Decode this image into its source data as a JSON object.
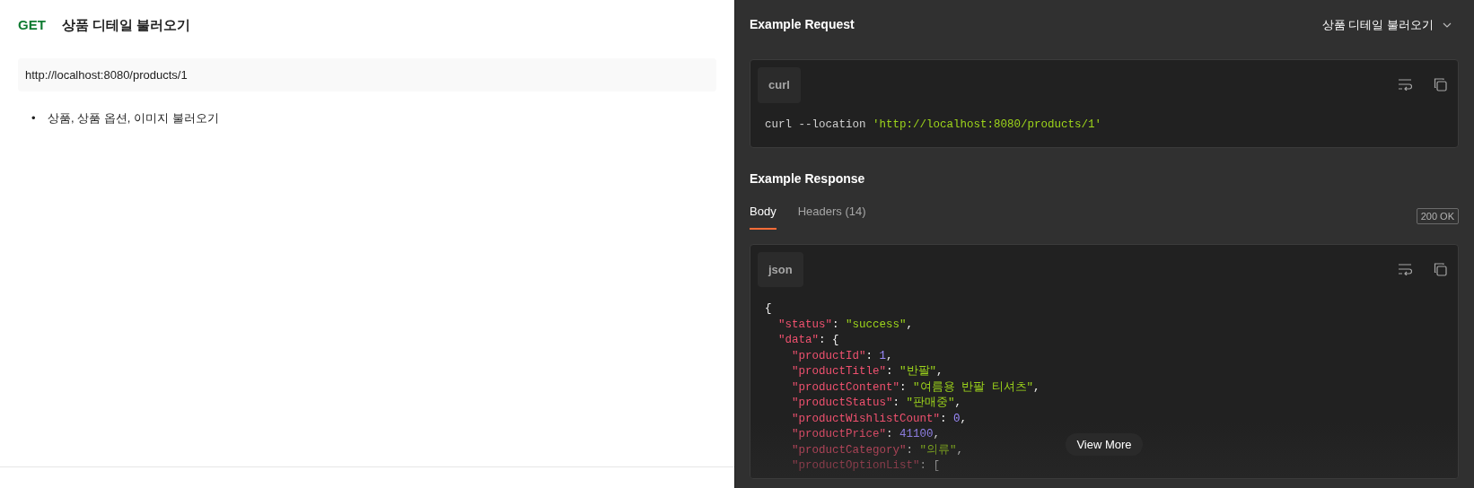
{
  "method": "GET",
  "title": "상품 디테일 불러오기",
  "url": "http://localhost:8080/products/1",
  "description_items": [
    {
      "bullet": "•",
      "text": "상품, 상품 옵션, 이미지 불러오기"
    }
  ],
  "example_request": {
    "title": "Example Request",
    "selector": "상품 디테일 불러오기",
    "code_block": {
      "language": "curl",
      "lines": [
        [
          {
            "kind": "plain",
            "text": "curl --location "
          },
          {
            "kind": "string",
            "text": "'http://localhost:8080/products/1'"
          }
        ]
      ]
    }
  },
  "example_response": {
    "title": "Example Response",
    "tabs": [
      {
        "label": "Body",
        "selected": true
      },
      {
        "label": "Headers (14)",
        "selected": false
      }
    ],
    "status_badge": "200 OK",
    "code_block": {
      "language": "json",
      "more_button": "View More",
      "lines": [
        [
          {
            "kind": "punct",
            "text": "{"
          }
        ],
        [
          {
            "kind": "key",
            "text": "  \"status\""
          },
          {
            "kind": "punct",
            "text": ": "
          },
          {
            "kind": "string",
            "text": "\"success\""
          },
          {
            "kind": "punct",
            "text": ","
          }
        ],
        [
          {
            "kind": "key",
            "text": "  \"data\""
          },
          {
            "kind": "punct",
            "text": ": {"
          }
        ],
        [
          {
            "kind": "key",
            "text": "    \"productId\""
          },
          {
            "kind": "punct",
            "text": ": "
          },
          {
            "kind": "number",
            "text": "1"
          },
          {
            "kind": "punct",
            "text": ","
          }
        ],
        [
          {
            "kind": "key",
            "text": "    \"productTitle\""
          },
          {
            "kind": "punct",
            "text": ": "
          },
          {
            "kind": "string",
            "text": "\"반팔\""
          },
          {
            "kind": "punct",
            "text": ","
          }
        ],
        [
          {
            "kind": "key",
            "text": "    \"productContent\""
          },
          {
            "kind": "punct",
            "text": ": "
          },
          {
            "kind": "string",
            "text": "\"여름용 반팔 티셔츠\""
          },
          {
            "kind": "punct",
            "text": ","
          }
        ],
        [
          {
            "kind": "key",
            "text": "    \"productStatus\""
          },
          {
            "kind": "punct",
            "text": ": "
          },
          {
            "kind": "string",
            "text": "\"판매중\""
          },
          {
            "kind": "punct",
            "text": ","
          }
        ],
        [
          {
            "kind": "key",
            "text": "    \"productWishlistCount\""
          },
          {
            "kind": "punct",
            "text": ": "
          },
          {
            "kind": "number",
            "text": "0"
          },
          {
            "kind": "punct",
            "text": ","
          }
        ],
        [
          {
            "kind": "key",
            "text": "    \"productPrice\""
          },
          {
            "kind": "punct",
            "text": ": "
          },
          {
            "kind": "number",
            "text": "41100"
          },
          {
            "kind": "punct",
            "text": ","
          }
        ],
        [
          {
            "kind": "key",
            "text": "    \"productCategory\""
          },
          {
            "kind": "punct",
            "text": ": "
          },
          {
            "kind": "string",
            "text": "\"의류\""
          },
          {
            "kind": "punct",
            "text": ","
          }
        ],
        [
          {
            "kind": "key",
            "text": "    \"productOptionList\""
          },
          {
            "kind": "punct",
            "text": ": ["
          }
        ]
      ]
    }
  }
}
